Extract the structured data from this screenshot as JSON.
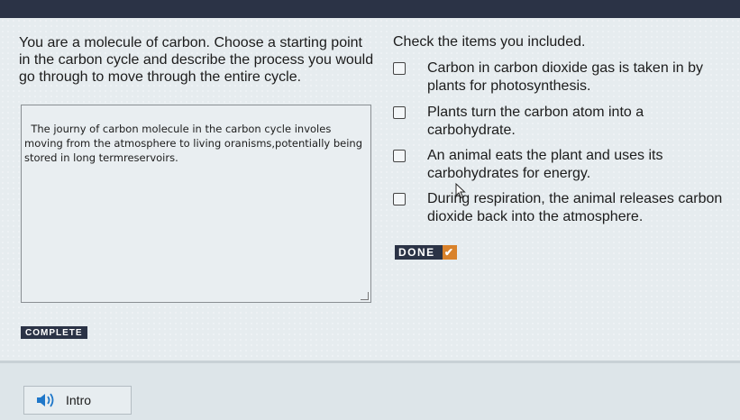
{
  "prompt": {
    "text": "You are a molecule of carbon. Choose a starting point in the carbon cycle and describe the process you would go through to move through the entire cycle."
  },
  "response": {
    "value": "The journy of carbon molecule in the carbon cycle involes moving from the atmosphere to living oranisms,potentially being stored in long termreservoirs."
  },
  "checklist": {
    "title": "Check the items you included.",
    "items": [
      {
        "label": "Carbon in carbon dioxide gas is taken in by plants for photosynthesis.",
        "checked": false
      },
      {
        "label": "Plants turn the carbon atom into a carbohydrate.",
        "checked": false
      },
      {
        "label": "An animal eats the plant and uses its carbohydrates for energy.",
        "checked": false
      },
      {
        "label": "During respiration, the animal releases carbon dioxide back into the atmosphere.",
        "checked": false
      }
    ]
  },
  "done_button": {
    "label": "DONE",
    "icon": "check-icon"
  },
  "status": {
    "label": "COMPLETE"
  },
  "intro_button": {
    "label": "Intro",
    "icon": "speaker-icon"
  },
  "colors": {
    "badge_bg": "#2b3346",
    "done_check": "#d9822b"
  }
}
